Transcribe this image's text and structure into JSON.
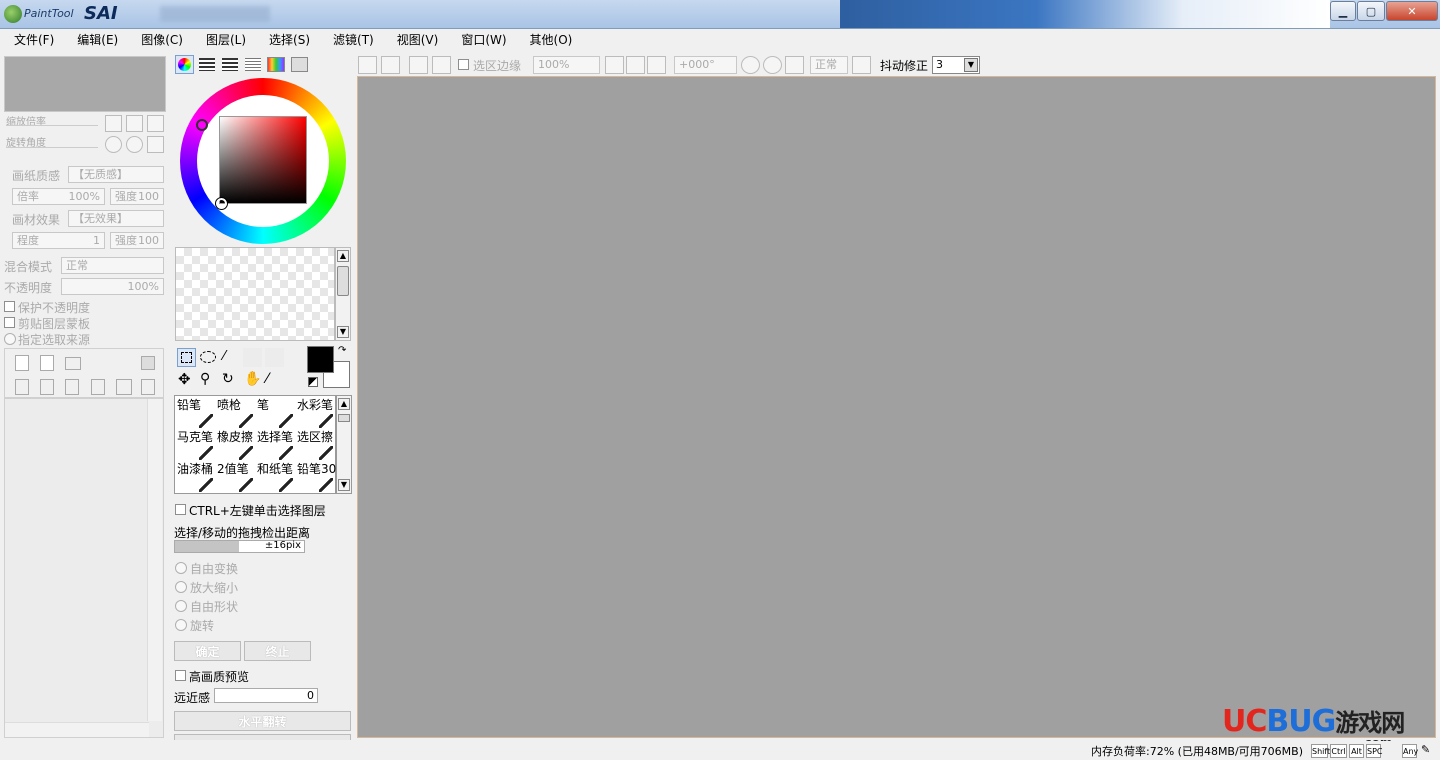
{
  "window": {
    "logo_brand": "PaintTool",
    "logo_name": "SAI",
    "title": "无标题",
    "min_glyph": "▁",
    "max_glyph": "▢",
    "close_glyph": "✕"
  },
  "menu": [
    {
      "label": "文件(F)"
    },
    {
      "label": "编辑(E)"
    },
    {
      "label": "图像(C)"
    },
    {
      "label": "图层(L)"
    },
    {
      "label": "选择(S)"
    },
    {
      "label": "滤镜(T)"
    },
    {
      "label": "视图(V)"
    },
    {
      "label": "窗口(W)"
    },
    {
      "label": "其他(O)"
    }
  ],
  "navigator": {
    "zoom_label": "缩放倍率",
    "rotate_label": "旋转角度"
  },
  "texture": {
    "paper_label": "画纸质感",
    "paper_value": "【无质感】",
    "scale_label": "倍率",
    "scale_value": "100%",
    "strength_label": "强度",
    "strength_value": "100",
    "effect_label": "画材效果",
    "effect_value": "【无效果】",
    "degree_label": "程度",
    "degree_value": "1",
    "strength2_label": "强度",
    "strength2_value": "100"
  },
  "layer_props": {
    "blend_label": "混合模式",
    "blend_value": "正常",
    "opacity_label": "不透明度",
    "opacity_value": "100%",
    "protect_opacity": "保护不透明度",
    "clip_group": "剪贴图层蒙板",
    "selection_source": "指定选取来源"
  },
  "color": {
    "primary": "#000000",
    "secondary": "#ffffff"
  },
  "brushes": [
    {
      "label": "铅笔",
      "icon": "pencil-icon"
    },
    {
      "label": "喷枪",
      "icon": "airbrush-icon"
    },
    {
      "label": "笔",
      "icon": "pen-icon"
    },
    {
      "label": "水彩笔",
      "icon": "watercolor-icon"
    },
    {
      "label": "马克笔",
      "icon": "marker-icon"
    },
    {
      "label": "橡皮擦",
      "icon": "eraser-icon"
    },
    {
      "label": "选择笔",
      "icon": "select-pen-icon"
    },
    {
      "label": "选区擦",
      "icon": "select-eraser-icon"
    },
    {
      "label": "油漆桶",
      "icon": "bucket-icon"
    },
    {
      "label": "2值笔",
      "icon": "binary-pen-icon"
    },
    {
      "label": "和纸笔",
      "icon": "washi-pen-icon"
    },
    {
      "label": "铅笔30",
      "icon": "pencil30-icon"
    }
  ],
  "transform": {
    "ctrl_select": "CTRL+左键单击选择图层",
    "drag_label": "选择/移动的拖拽检出距离",
    "drag_value": "±16pix",
    "free_transform": "自由变换",
    "scale": "放大缩小",
    "free_shape": "自由形状",
    "rotate": "旋转",
    "ok": "确定",
    "cancel": "终止",
    "hq_preview": "高画质预览",
    "perspective_label": "远近感",
    "perspective_value": "0",
    "flip_h": "水平翻转"
  },
  "toolbar": {
    "sel_edge": "选区边缘",
    "zoom": "100%",
    "angle": "+000°",
    "blend": "正常",
    "stabilizer_label": "抖动修正",
    "stabilizer_value": "3"
  },
  "status": {
    "memory": "内存负荷率:72% (已用48MB/可用706MB)",
    "keys": [
      "Shift",
      "Ctrl",
      "Alt",
      "SPC",
      "Any"
    ],
    "watermark_uc": "UC",
    "watermark_bug": "BUG",
    "watermark_cn": "游戏网",
    "watermark_com": ".com"
  }
}
